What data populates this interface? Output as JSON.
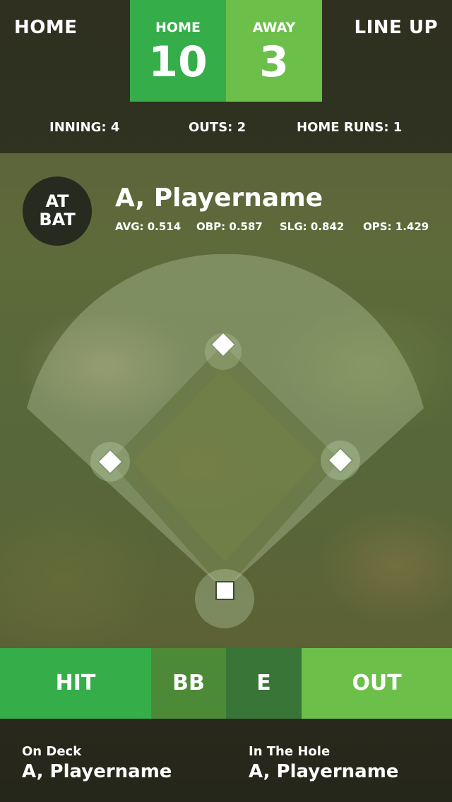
{
  "header": {
    "home_link": "HOME",
    "lineup_link": "LINE UP"
  },
  "score": {
    "home": {
      "label": "HOME",
      "value": "10"
    },
    "away": {
      "label": "AWAY",
      "value": "3"
    }
  },
  "game_stats": {
    "inning": "INNING:  4",
    "outs": "OUTS:  2",
    "home_runs": "HOME RUNS:  1"
  },
  "at_bat": {
    "badge_line1": "AT",
    "badge_line2": "BAT",
    "player_name": "A, Playername",
    "stats": {
      "avg": "AVG: 0.514",
      "obp": "OBP: 0.587",
      "slg": "SLG: 0.842",
      "ops": "OPS: 1.429"
    }
  },
  "actions": {
    "hit": "HIT",
    "bb": "BB",
    "e": "E",
    "out": "OUT"
  },
  "queue": {
    "on_deck": {
      "label": "On Deck",
      "name": "A, Playername"
    },
    "in_the_hole": {
      "label": "In The Hole",
      "name": "A, Playername"
    }
  },
  "colors": {
    "home_green": "#35ae4a",
    "away_green": "#6cc04a",
    "bb_green": "#4d8a38",
    "e_green": "#3a7538"
  },
  "icons": [
    "second-base-icon",
    "first-base-icon",
    "third-base-icon",
    "home-plate-icon"
  ]
}
